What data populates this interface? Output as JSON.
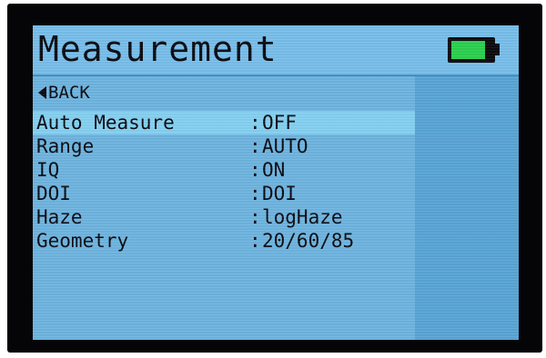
{
  "header": {
    "title": "Measurement",
    "battery_level": 0.85,
    "battery_color": "#2cd24f"
  },
  "nav": {
    "back_label": "BACK"
  },
  "menu": {
    "separator": ":",
    "items": [
      {
        "label": "Auto Measure",
        "value": "OFF",
        "selected": true
      },
      {
        "label": "Range",
        "value": "AUTO"
      },
      {
        "label": "IQ",
        "value": "ON"
      },
      {
        "label": "DOI",
        "value": "DOI"
      },
      {
        "label": "Haze",
        "value": "logHaze"
      },
      {
        "label": "Geometry",
        "value": "20/60/85"
      }
    ]
  },
  "colors": {
    "screen_bg": "#6fb6e2",
    "selection_bg": "#86d2f3",
    "text": "#0b0b12",
    "side_panel": "#5aa6d7"
  }
}
